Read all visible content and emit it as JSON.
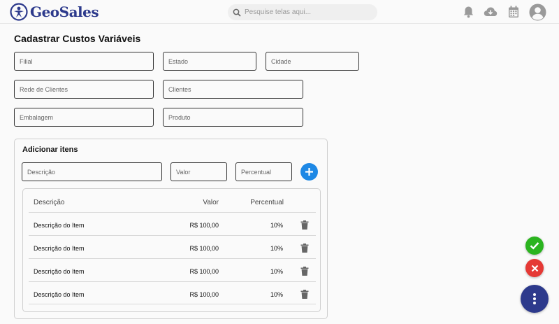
{
  "app": {
    "logo_text": "GeoSales"
  },
  "search": {
    "placeholder": "Pesquise telas aqui..."
  },
  "header_icons": [
    "bell-icon",
    "cloud-download-icon",
    "calendar-icon",
    "account-icon"
  ],
  "page": {
    "title": "Cadastrar Custos Variáveis"
  },
  "form": {
    "filial": "Filial",
    "estado": "Estado",
    "cidade": "Cidade",
    "rede_clientes": "Rede de Clientes",
    "clientes": "Clientes",
    "embalagem": "Embalagem",
    "produto": "Produto"
  },
  "items_panel": {
    "title": "Adicionar itens",
    "descricao_placeholder": "Descrição",
    "valor_placeholder": "Valor",
    "percentual_placeholder": "Percentual",
    "columns": {
      "descricao": "Descrição",
      "valor": "Valor",
      "percentual": "Percentual"
    },
    "rows": [
      {
        "descricao": "Descrição do Item",
        "valor": "R$ 100,00",
        "percentual": "10%"
      },
      {
        "descricao": "Descrição do Item",
        "valor": "R$ 100,00",
        "percentual": "10%"
      },
      {
        "descricao": "Descrição do Item",
        "valor": "R$ 100,00",
        "percentual": "10%"
      },
      {
        "descricao": "Descrição do Item",
        "valor": "R$ 100,00",
        "percentual": "10%"
      }
    ]
  },
  "colors": {
    "brand": "#2d3a8c",
    "add": "#1e88e5",
    "confirm": "#2bb41f",
    "cancel": "#e53935",
    "more": "#2d3a8c"
  }
}
